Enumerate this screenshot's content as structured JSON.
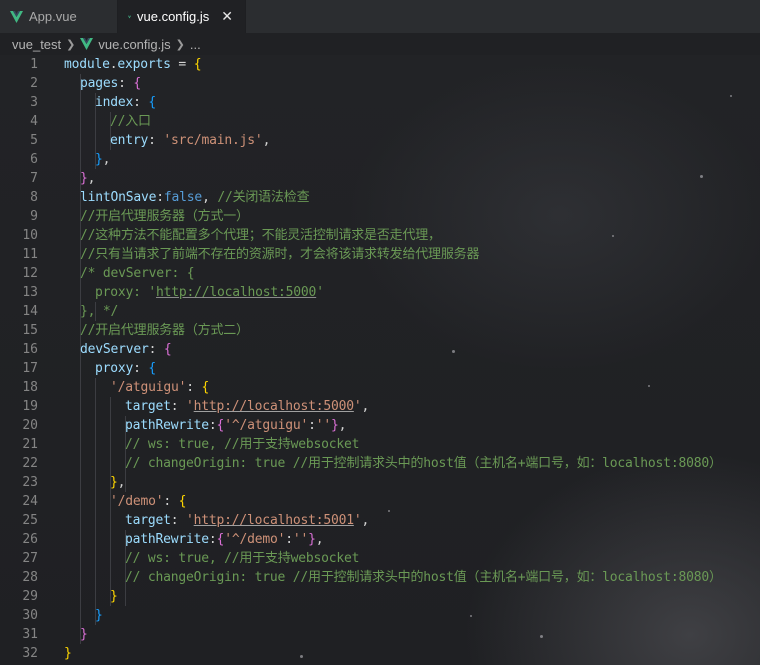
{
  "tabs": [
    {
      "label": "App.vue",
      "icon": "vue-icon",
      "active": false
    },
    {
      "label": "vue.config.js",
      "icon": "vue-icon",
      "active": true,
      "close_glyph": "✕"
    }
  ],
  "breadcrumb": {
    "folder": "vue_test",
    "file": "vue.config.js",
    "more": "..."
  },
  "line_numbers": [
    "1",
    "2",
    "3",
    "4",
    "5",
    "6",
    "7",
    "8",
    "9",
    "10",
    "11",
    "12",
    "13",
    "14",
    "15",
    "16",
    "17",
    "18",
    "19",
    "20",
    "21",
    "22",
    "23",
    "24",
    "25",
    "26",
    "27",
    "28",
    "29",
    "30",
    "31",
    "32"
  ],
  "code": {
    "l1": {
      "a": "module",
      "b": ".",
      "c": "exports",
      "d": " = ",
      "e": "{"
    },
    "l2": {
      "a": "pages",
      "b": ": ",
      "c": "{"
    },
    "l3": {
      "a": "index",
      "b": ": ",
      "c": "{"
    },
    "l4": {
      "a": "//入口"
    },
    "l5": {
      "a": "entry",
      "b": ": ",
      "c": "'src/main.js'",
      "d": ","
    },
    "l6": {
      "a": "}",
      "b": ","
    },
    "l7": {
      "a": "}",
      "b": ","
    },
    "l8": {
      "a": "lintOnSave",
      "b": ":",
      "c": "false",
      "d": ", ",
      "e": "//关闭语法检查"
    },
    "l9": {
      "a": "//开启代理服务器（方式一）"
    },
    "l10": {
      "a": "//这种方法不能配置多个代理；不能灵活控制请求是否走代理，"
    },
    "l11": {
      "a": "//只有当请求了前端不存在的资源时，才会将该请求转发给代理服务器"
    },
    "l12": {
      "a": "/* devServer: {"
    },
    "l13": {
      "a": "proxy: '",
      "b": "http://localhost:5000",
      "c": "'"
    },
    "l14": {
      "a": "}, */"
    },
    "l15": {
      "a": "//开启代理服务器（方式二）"
    },
    "l16": {
      "a": "devServer",
      "b": ": ",
      "c": "{"
    },
    "l17": {
      "a": "proxy",
      "b": ": ",
      "c": "{"
    },
    "l18": {
      "a": "'/atguigu'",
      "b": ": ",
      "c": "{"
    },
    "l19": {
      "a": "target",
      "b": ": ",
      "c": "'",
      "d": "http://localhost:5000",
      "e": "'",
      "f": ","
    },
    "l20": {
      "a": "pathRewrite",
      "b": ":",
      "c": "{",
      "d": "'^/atguigu'",
      "e": ":",
      "f": "''",
      "g": "}",
      "h": ","
    },
    "l21": {
      "a": "// ws: true, //用于支持websocket"
    },
    "l22": {
      "a": "// changeOrigin: true //用于控制请求头中的host值（主机名+端口号，如：localhost:8080）"
    },
    "l23": {
      "a": "}",
      "b": ","
    },
    "l24": {
      "a": "'/demo'",
      "b": ": ",
      "c": "{"
    },
    "l25": {
      "a": "target",
      "b": ": ",
      "c": "'",
      "d": "http://localhost:5001",
      "e": "'",
      "f": ","
    },
    "l26": {
      "a": "pathRewrite",
      "b": ":",
      "c": "{",
      "d": "'^/demo'",
      "e": ":",
      "f": "''",
      "g": "}",
      "h": ","
    },
    "l27": {
      "a": "// ws: true, //用于支持websocket"
    },
    "l28": {
      "a": "// changeOrigin: true //用于控制请求头中的host值（主机名+端口号，如：localhost:8080）"
    },
    "l29": {
      "a": "}"
    },
    "l30": {
      "a": "}"
    },
    "l31": {
      "a": "}"
    },
    "l32": {
      "a": "}"
    }
  },
  "colors": {
    "keyword": "#569cd6",
    "property": "#9cdcfe",
    "string": "#ce9178",
    "comment": "#6a9955",
    "brace_level1": "#ffd700",
    "brace_level2": "#da70d6",
    "brace_level3": "#179fff",
    "vue_green": "#41b883"
  }
}
